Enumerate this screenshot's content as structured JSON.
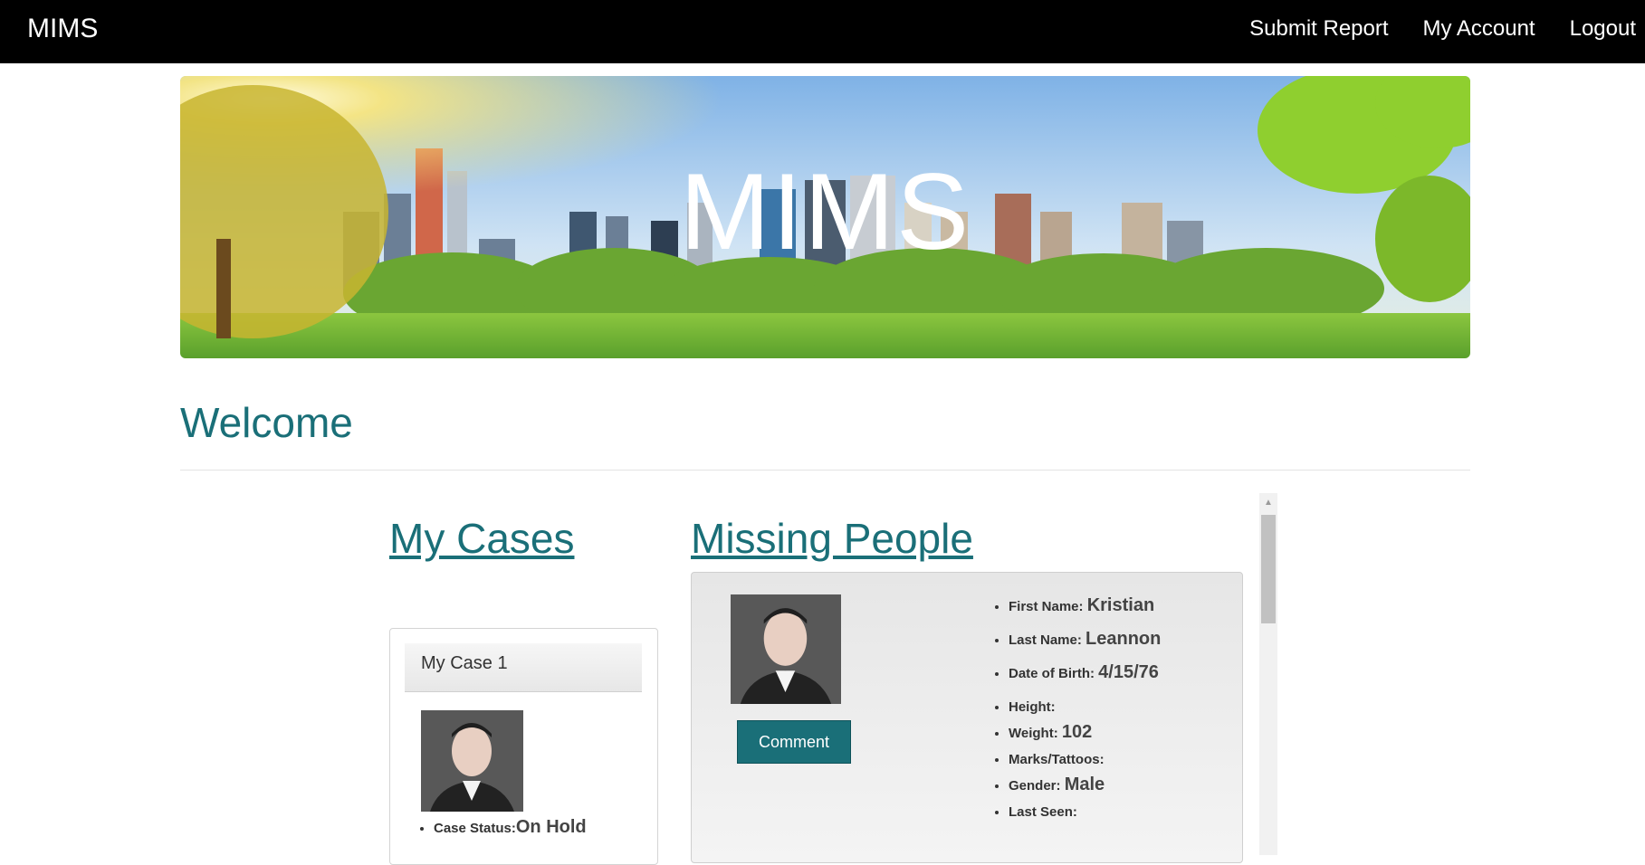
{
  "nav": {
    "brand": "MIMS",
    "links": [
      "Submit Report",
      "My Account",
      "Logout"
    ]
  },
  "hero": {
    "title": "MIMS"
  },
  "welcome": "Welcome",
  "sections": {
    "my_cases": "My Cases",
    "missing_people": "Missing People"
  },
  "my_case": {
    "title": "My Case 1",
    "status_label": "Case Status:",
    "status_value": "On Hold"
  },
  "missing_person": {
    "comment_label": "Comment",
    "fields": [
      {
        "label": "First Name:",
        "value": "Kristian"
      },
      {
        "label": "Last Name:",
        "value": "Leannon"
      },
      {
        "label": "Date of Birth:",
        "value": "4/15/76"
      },
      {
        "label": "Height:",
        "value": ""
      },
      {
        "label": "Weight:",
        "value": "102"
      },
      {
        "label": "Marks/Tattoos:",
        "value": ""
      },
      {
        "label": "Gender:",
        "value": "Male"
      },
      {
        "label": "Last Seen:",
        "value": ""
      }
    ]
  },
  "colors": {
    "accent": "#1a6f78",
    "nav_bg": "#000000",
    "button_bg": "#1a6f78"
  }
}
